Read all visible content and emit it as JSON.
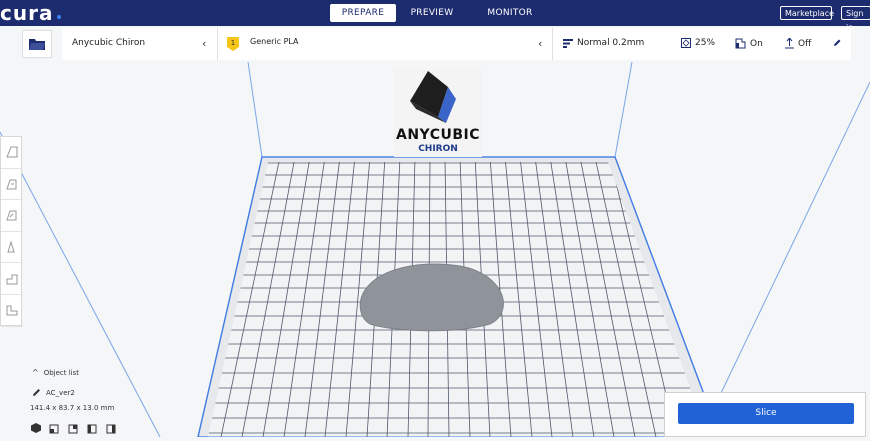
{
  "app": {
    "logo": "cura"
  },
  "stages": [
    {
      "label": "PREPARE"
    },
    {
      "label": "PREVIEW"
    },
    {
      "label": "MONITOR"
    }
  ],
  "account": {
    "marketplace": "Marketplace",
    "signin": "Sign in"
  },
  "printer": {
    "name": "Anycubic Chiron"
  },
  "material": {
    "name": "Generic PLA"
  },
  "settings": {
    "profile": "Normal 0.2mm",
    "infill": "25%",
    "support": "On",
    "adhesion": "Off"
  },
  "bed_logo": {
    "brand": "ANYCUBIC",
    "model": "CHIRON"
  },
  "object_list": {
    "header": "Object list",
    "object_name": "AC_ver2",
    "dimensions": "141.4 x 83.7 x 13.0 mm"
  },
  "slice": {
    "label": "Slice"
  },
  "colors": {
    "topbar": "#1d2b6f",
    "accent": "#2163d6",
    "grid": "#2d6cdf",
    "material_badge": "#f5c518"
  }
}
